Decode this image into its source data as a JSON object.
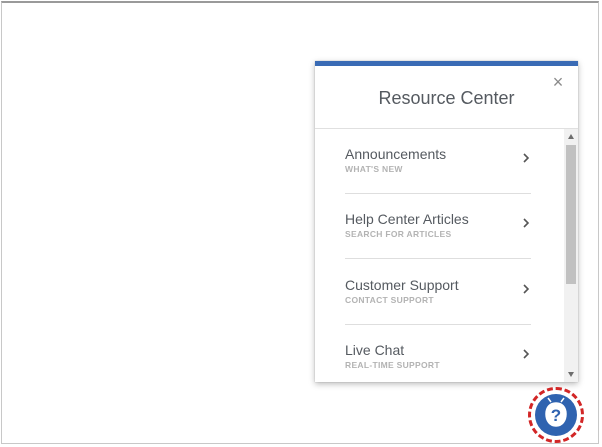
{
  "resource_center": {
    "title": "Resource Center",
    "close_glyph": "×",
    "items": [
      {
        "label": "Announcements",
        "sub": "WHAT'S NEW"
      },
      {
        "label": "Help Center Articles",
        "sub": "SEARCH FOR ARTICLES"
      },
      {
        "label": "Customer Support",
        "sub": "CONTACT SUPPORT"
      },
      {
        "label": "Live Chat",
        "sub": "REAL-TIME SUPPORT"
      }
    ]
  },
  "launcher": {
    "icon": "question-mark-icon"
  },
  "colors": {
    "accent_bar": "#3a6bb5",
    "launcher_fill": "#2f63b0",
    "launcher_ring": "#d22626"
  }
}
